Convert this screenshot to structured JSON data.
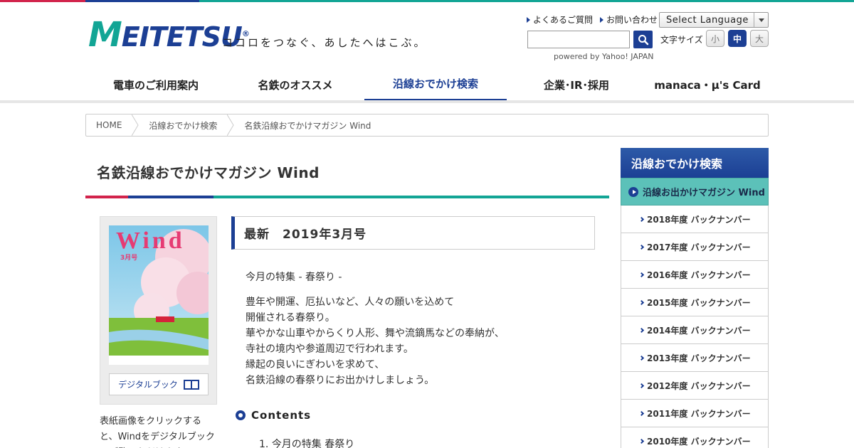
{
  "header": {
    "logo_text": "MEITETSU",
    "tagline": "ココロをつなぐ、あしたへはこぶ。",
    "links": [
      {
        "label": "よくあるご質問"
      },
      {
        "label": "お問い合わせ"
      }
    ],
    "language_select": "Select Language",
    "search": {
      "placeholder": "",
      "powered_by": "powered by Yahoo! JAPAN"
    },
    "font_size": {
      "label": "文字サイズ",
      "options": [
        "小",
        "中",
        "大"
      ],
      "selected": "中"
    }
  },
  "nav": {
    "items": [
      {
        "label": "電車のご利用案内"
      },
      {
        "label": "名鉄のオススメ"
      },
      {
        "label": "沿線おでかけ検索"
      },
      {
        "label": "企業･IR･採用"
      },
      {
        "label": "manaca・μ's Card"
      }
    ],
    "active": "沿線おでかけ検索"
  },
  "breadcrumb": [
    "HOME",
    "沿線おでかけ検索",
    "名鉄沿線おでかけマガジン Wind"
  ],
  "main": {
    "title": "名鉄沿線おでかけマガジン Wind",
    "issue_heading": "最新　2019年3月号",
    "feature": "今月の特集 - 春祭り -",
    "body_lines": [
      "豊年や開運、厄払いなど、人々の願いを込めて",
      "開催される春祭り。",
      "華やかな山車やからくり人形、舞や流鏑馬などの奉納が、",
      "寺社の境内や参道周辺で行われます。",
      "縁起の良いにぎわいを求めて、",
      "名鉄沿線の春祭りにお出かけしましょう。"
    ],
    "contents_heading": "Contents",
    "contents_items": [
      "今月の特集 春祭り"
    ],
    "cover": {
      "brand": "Wind",
      "month": "3月号",
      "digital_button": "デジタルブック",
      "caption": "表紙画像をクリックすると、Windをデジタルブックでご覧いただけます。"
    }
  },
  "sidebar": {
    "heading": "沿線おでかけ検索",
    "active_item": "沿線お出かけマガジン Wind",
    "items": [
      "2018年度 バックナンバー",
      "2017年度 バックナンバー",
      "2016年度 バックナンバー",
      "2015年度 バックナンバー",
      "2014年度 バックナンバー",
      "2013年度 バックナンバー",
      "2012年度 バックナンバー",
      "2011年度 バックナンバー",
      "2010年度 バックナンバー"
    ]
  },
  "colors": {
    "brand_navy": "#1c3f94",
    "brand_teal": "#12a595",
    "brand_red": "#d2234b",
    "sidebar_active": "#5cc1b9"
  }
}
